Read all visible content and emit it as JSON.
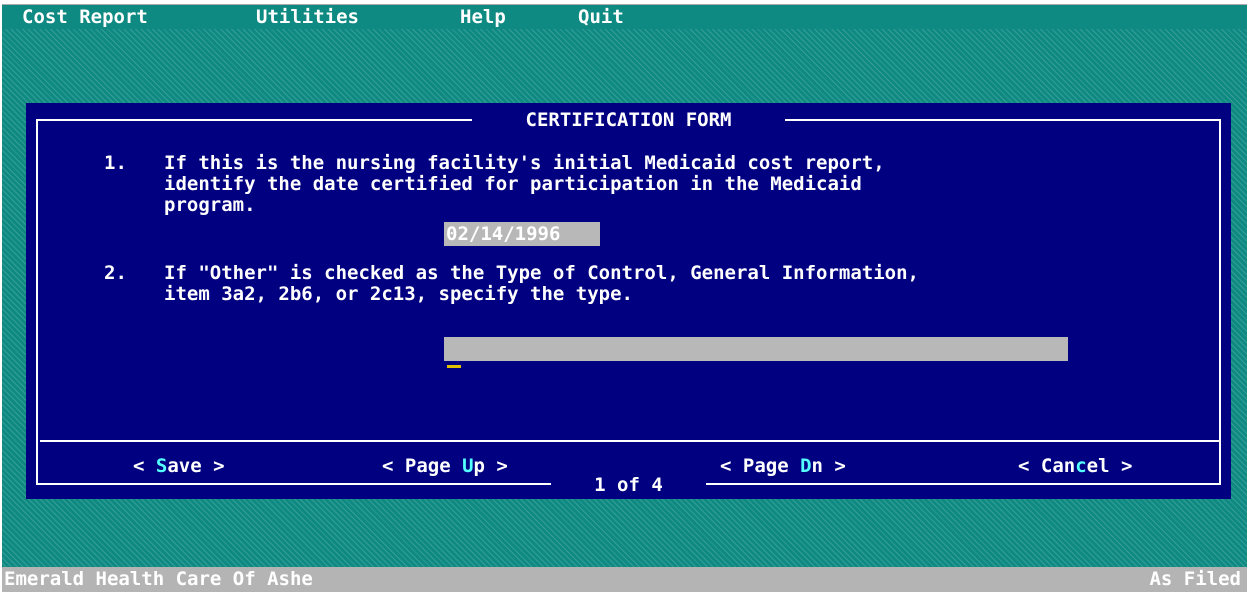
{
  "menu": {
    "cost_report": "Cost Report",
    "utilities": "Utilities",
    "help": "Help",
    "quit": "Quit"
  },
  "dialog": {
    "title": "CERTIFICATION FORM",
    "questions": [
      {
        "number": "1.",
        "lines": [
          "If this is the nursing facility's initial Medicaid cost report,",
          "identify the date certified for participation in the Medicaid",
          "program."
        ],
        "value": "02/14/1996"
      },
      {
        "number": "2.",
        "lines": [
          "If \"Other\" is checked as the Type of Control, General Information,",
          "item 3a2, 2b6, or 2c13, specify the type."
        ],
        "value": ""
      }
    ],
    "buttons": {
      "save": {
        "open": "< ",
        "hot": "S",
        "rest": "ave >"
      },
      "page_up": {
        "pre": "< Page ",
        "hot": "U",
        "rest": "p >"
      },
      "page_dn": {
        "pre": "< Page ",
        "hot": "D",
        "rest": "n >"
      },
      "cancel": {
        "pre": "< Can",
        "hot": "c",
        "rest": "el >"
      }
    },
    "page_indicator": "1 of 4"
  },
  "status": {
    "facility": "Emerald Health Care Of Ashe",
    "mode": "As Filed"
  },
  "colors": {
    "background": "#0e8a82",
    "dialog": "#000080",
    "hotkey": "#55ffff",
    "field": "#b8b8b8",
    "statusbar": "#b4b4b4"
  }
}
